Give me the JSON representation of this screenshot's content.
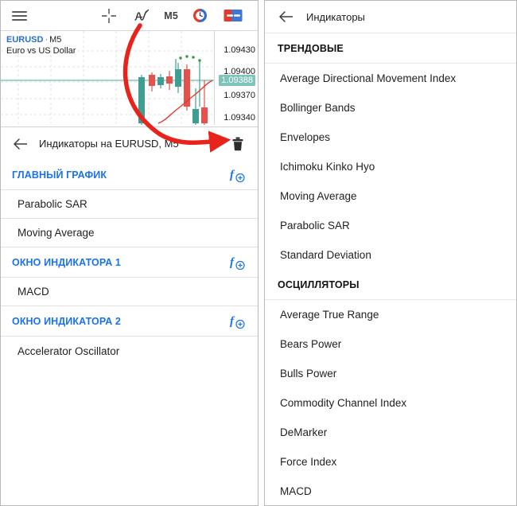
{
  "toolbar": {
    "menu_icon": "hamburger-menu-icon",
    "crosshair_icon": "crosshair-icon",
    "indicators_icon": "indicators-icon",
    "timeframe_label": "M5",
    "clock_icon": "trade-clock-icon",
    "window_icon": "new-chart-icon"
  },
  "chart": {
    "symbol_code": "EURUSD",
    "separator": "·",
    "timeframe": "M5",
    "description": "Euro vs US Dollar",
    "current_price": "1.09388",
    "price_labels": [
      "1.09430",
      "1.09400",
      "1.09370",
      "1.09340"
    ],
    "bull_color": "#3f9e91",
    "bear_color": "#e5524b",
    "sar_dot_color": "#2e9b3c",
    "ma_line_color": "#e03a2f",
    "grid_color": "#e1e1e1",
    "price_line_color": "#a9d4cd"
  },
  "left_panel": {
    "back_icon": "back-arrow-icon",
    "title": "Индикаторы на EURUSD, M5",
    "delete_icon": "trash-icon",
    "add_icon": "add-indicator-icon",
    "groups": [
      {
        "title": "ГЛАВНЫЙ ГРАФИК",
        "items": [
          "Parabolic SAR",
          "Moving Average"
        ]
      },
      {
        "title": "ОКНО ИНДИКАТОРА 1",
        "items": [
          "MACD"
        ]
      },
      {
        "title": "ОКНО ИНДИКАТОРА 2",
        "items": [
          "Accelerator Oscillator"
        ]
      }
    ]
  },
  "right_panel": {
    "back_icon": "back-arrow-icon",
    "title": "Индикаторы",
    "groups": [
      {
        "title": "ТРЕНДОВЫЕ",
        "items": [
          "Average Directional Movement Index",
          "Bollinger Bands",
          "Envelopes",
          "Ichimoku Kinko Hyo",
          "Moving Average",
          "Parabolic SAR",
          "Standard Deviation"
        ]
      },
      {
        "title": "ОСЦИЛЛЯТОРЫ",
        "items": [
          "Average True Range",
          "Bears Power",
          "Bulls Power",
          "Commodity Channel Index",
          "DeMarker",
          "Force Index",
          "MACD"
        ]
      }
    ]
  },
  "annotation": {
    "arrow_color": "#e8231c",
    "arrow_name": "red-callout-arrow"
  }
}
